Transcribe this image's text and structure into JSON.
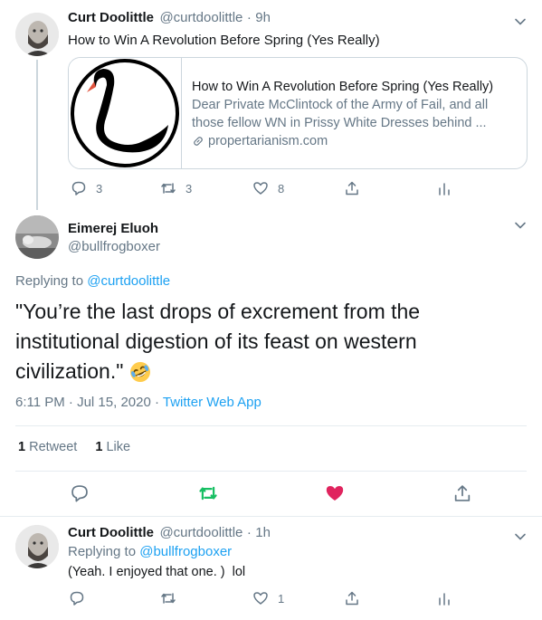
{
  "tweet1": {
    "name": "Curt Doolittle",
    "handle": "@curtdoolittle",
    "sep": "·",
    "time": "9h",
    "text": "How to Win A Revolution Before Spring (Yes Really)",
    "card": {
      "title": "How to Win A Revolution Before Spring (Yes Really)",
      "desc_line1": "Dear Private McClintock of the Army of Fail, and all",
      "desc_line2": "those fellow WN in Prissy White Dresses behind ...",
      "domain": "propertarianism.com"
    },
    "actions": {
      "replies": "3",
      "retweets": "3",
      "likes": "8"
    }
  },
  "tweet2": {
    "name": "Eimerej Eluoh",
    "handle": "@bullfrogboxer",
    "replying_prefix": "Replying to",
    "replying_to": "@curtdoolittle",
    "text_line1": "\"You’re the last drops of excrement from the",
    "text_line2": "institutional digestion of its feast on western",
    "text_line3": "civilization.\"",
    "time": "6:11 PM · Jul 15, 2020",
    "sep": "·",
    "source": "Twitter Web App",
    "retweet_count": "1",
    "retweet_label": "Retweet",
    "like_count": "1",
    "like_label": "Like"
  },
  "tweet3": {
    "name": "Curt Doolittle",
    "handle": "@curtdoolittle",
    "sep": "·",
    "time": "1h",
    "replying_prefix": "Replying to",
    "replying_to": "@bullfrogboxer",
    "text": "(Yeah. I enjoyed that one. )  lol",
    "actions": {
      "likes": "1"
    }
  },
  "colors": {
    "accent": "#1da1f2",
    "muted": "#657786",
    "retweet_green": "#17bf63",
    "like_red": "#e0245e"
  }
}
